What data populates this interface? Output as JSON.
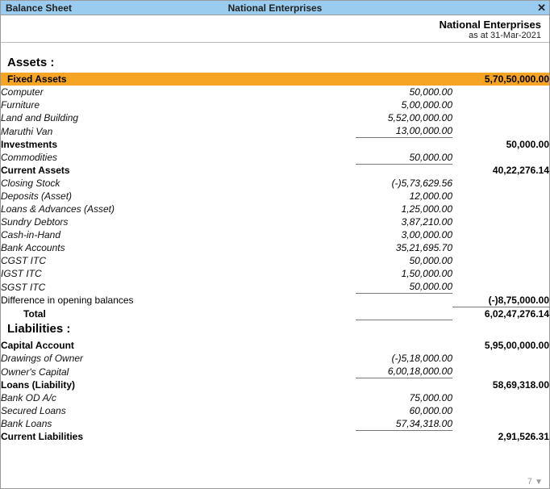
{
  "titlebar": {
    "left": "Balance Sheet",
    "center": "National Enterprises",
    "close": "✕"
  },
  "header": {
    "company": "National Enterprises",
    "asat": "as at 31-Mar-2021"
  },
  "sections": {
    "assets": "Assets :",
    "liabilities": "Liabilities :"
  },
  "assets": {
    "fixed": {
      "label": "Fixed Assets",
      "total": "5,70,50,000.00",
      "items": [
        {
          "label": "Computer",
          "value": "50,000.00"
        },
        {
          "label": "Furniture",
          "value": "5,00,000.00"
        },
        {
          "label": "Land and Building",
          "value": "5,52,00,000.00"
        },
        {
          "label": "Maruthi Van",
          "value": "13,00,000.00"
        }
      ]
    },
    "inv": {
      "label": "Investments",
      "total": "50,000.00",
      "items": [
        {
          "label": "Commodities",
          "value": "50,000.00"
        }
      ]
    },
    "current": {
      "label": "Current Assets",
      "total": "40,22,276.14",
      "items": [
        {
          "label": "Closing Stock",
          "value": "(-)5,73,629.56"
        },
        {
          "label": "Deposits (Asset)",
          "value": "12,000.00"
        },
        {
          "label": "Loans & Advances (Asset)",
          "value": "1,25,000.00"
        },
        {
          "label": "Sundry Debtors",
          "value": "3,87,210.00"
        },
        {
          "label": "Cash-in-Hand",
          "value": "3,00,000.00"
        },
        {
          "label": "Bank Accounts",
          "value": "35,21,695.70"
        },
        {
          "label": "CGST ITC",
          "value": "50,000.00"
        },
        {
          "label": "IGST ITC",
          "value": "1,50,000.00"
        },
        {
          "label": "SGST ITC",
          "value": "50,000.00"
        }
      ]
    },
    "diff": {
      "label": "Difference in opening balances",
      "total": "(-)8,75,000.00"
    },
    "total": {
      "label": "Total",
      "value": "6,02,47,276.14"
    }
  },
  "liab": {
    "capital": {
      "label": "Capital Account",
      "total": "5,95,00,000.00",
      "items": [
        {
          "label": "Drawings of Owner",
          "value": "(-)5,18,000.00"
        },
        {
          "label": "Owner's Capital",
          "value": "6,00,18,000.00"
        }
      ]
    },
    "loans": {
      "label": "Loans (Liability)",
      "total": "58,69,318.00",
      "items": [
        {
          "label": "Bank OD A/c",
          "value": "75,000.00"
        },
        {
          "label": "Secured Loans",
          "value": "60,000.00"
        },
        {
          "label": "Bank Loans",
          "value": "57,34,318.00"
        }
      ]
    },
    "curliab": {
      "label": "Current Liabilities",
      "total": "2,91,526.31"
    }
  },
  "footer": {
    "num": "7",
    "tri": "▼"
  }
}
